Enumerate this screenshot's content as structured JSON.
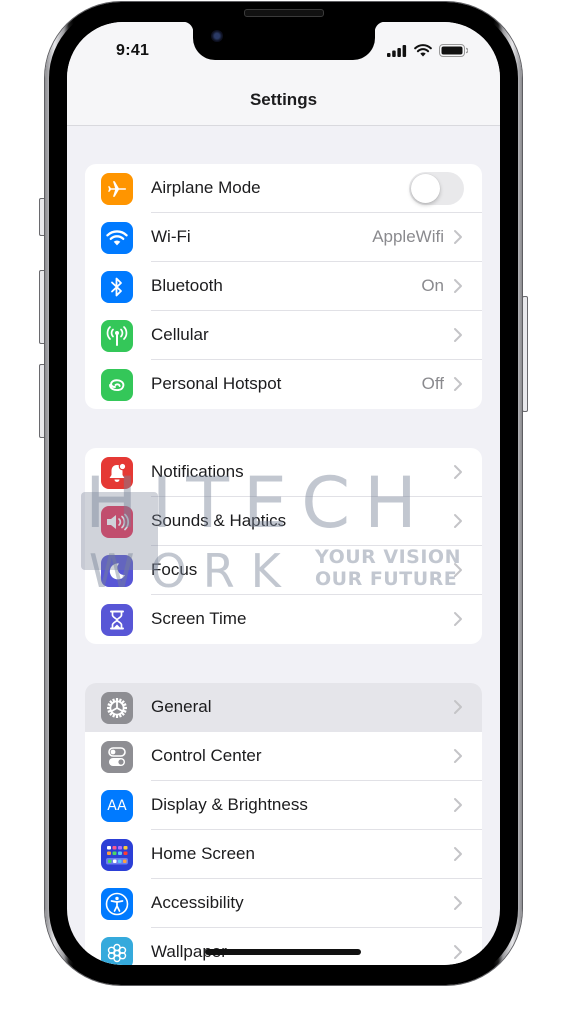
{
  "status_bar": {
    "time": "9:41",
    "icons": [
      "cellular-signal-icon",
      "wifi-icon",
      "battery-icon"
    ]
  },
  "nav": {
    "title": "Settings"
  },
  "groups": [
    {
      "items": [
        {
          "label": "Airplane Mode",
          "icon": "airplane-icon",
          "color": "#FF9500",
          "control": "toggle",
          "toggle_on": false
        },
        {
          "label": "Wi-Fi",
          "icon": "wifi-icon",
          "color": "#007AFF",
          "value": "AppleWifi"
        },
        {
          "label": "Bluetooth",
          "icon": "bluetooth-icon",
          "color": "#007AFF",
          "value": "On"
        },
        {
          "label": "Cellular",
          "icon": "cellular-antenna-icon",
          "color": "#34C759"
        },
        {
          "label": "Personal Hotspot",
          "icon": "hotspot-link-icon",
          "color": "#34C759",
          "value": "Off"
        }
      ]
    },
    {
      "items": [
        {
          "label": "Notifications",
          "icon": "bell-icon",
          "color": "#E53935"
        },
        {
          "label": "Sounds & Haptics",
          "icon": "speaker-icon",
          "color": "#E8345A"
        },
        {
          "label": "Focus",
          "icon": "moon-icon",
          "color": "#5856D6"
        },
        {
          "label": "Screen Time",
          "icon": "hourglass-icon",
          "color": "#5856D6"
        }
      ]
    },
    {
      "items": [
        {
          "label": "General",
          "icon": "gear-icon",
          "color": "#8E8E93",
          "highlighted": true
        },
        {
          "label": "Control Center",
          "icon": "switches-icon",
          "color": "#8E8E93"
        },
        {
          "label": "Display & Brightness",
          "icon": "text-size-icon",
          "color": "#007AFF",
          "glyph": "AA"
        },
        {
          "label": "Home Screen",
          "icon": "home-screen-grid-icon",
          "color": "#2C3FD6"
        },
        {
          "label": "Accessibility",
          "icon": "accessibility-icon",
          "color": "#007AFF"
        },
        {
          "label": "Wallpaper",
          "icon": "flower-icon",
          "color": "#35AADC"
        }
      ]
    }
  ],
  "watermark": {
    "line1": "HITECH",
    "line2": "WORK",
    "tagline1": "YOUR VISION",
    "tagline2": "OUR FUTURE"
  }
}
